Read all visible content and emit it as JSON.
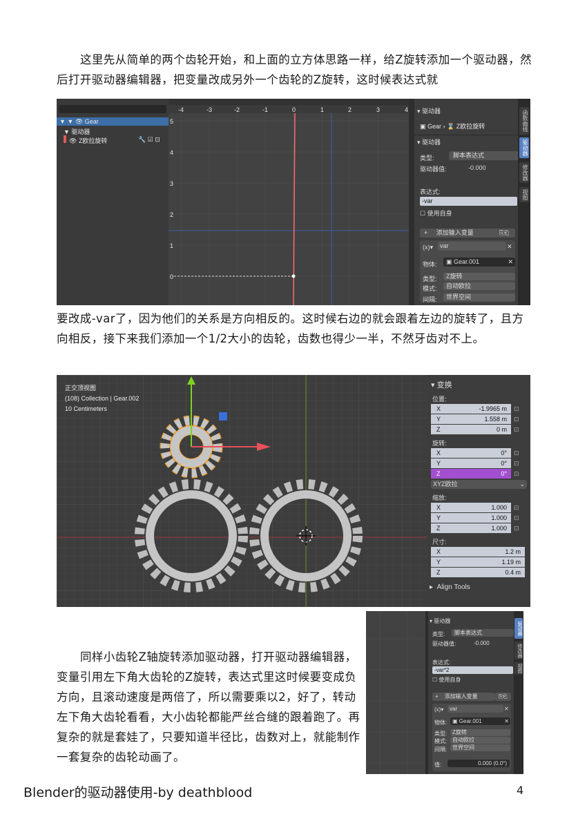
{
  "para1": "这里先从简单的两个齿轮开始，和上面的立方体思路一样，给Z旋转添加一个驱动器，然后打开驱动器编辑器，把变量改成另外一个齿轮的Z旋转，这时候表达式就",
  "para2": "要改成-var了，因为他们的关系是方向相反的。这时候右边的就会跟着左边的旋转了，且方向相反，接下来我们添加一个1/2大小的齿轮，齿数也得少一半，不然牙齿对不上。",
  "para3": "同样小齿轮Z轴旋转添加驱动器，打开驱动器编辑器，变量引用左下角大齿轮的Z旋转，表达式里这时候要变成负方向，且滚动速度是两倍了，所以需要乘以2，好了，转动左下角大齿轮看看，大小齿轮都能严丝合缝的跟着跑了。再复杂的就是套娃了，只要知道半径比，齿数对上，就能制作一套复杂的齿轮动画了。",
  "footer": {
    "title": "Blender的驱动器使用-by deathblood",
    "page": "4"
  },
  "ss1": {
    "outliner": {
      "gear": "Gear",
      "drivers": "驱动器",
      "zrot": "Z欧拉旋转"
    },
    "xticks": [
      "-4",
      "-3",
      "-2",
      "-1",
      "0",
      "1",
      "2",
      "3",
      "4"
    ],
    "yticks": [
      "5",
      "4",
      "3",
      "2",
      "1",
      "0"
    ],
    "panel": {
      "header": "驱动器",
      "obj": "Gear",
      "prop": "Z欧拉旋转",
      "driver_header": "驱动器",
      "type_label": "类型:",
      "type_value": "脚本表达式",
      "value_label": "驱动器值:",
      "value": "-0.000",
      "expr_label": "表达式:",
      "expr": "-var",
      "use_self": "使用自身",
      "add_var": "添加输入变量",
      "var_name": "var",
      "obj_label": "物体:",
      "obj_value": "Gear.001",
      "ttype_label": "类型:",
      "ttype": "Z旋转",
      "mode_label": "模式:",
      "mode": "自动欧拉",
      "space_label": "间隔:",
      "space": "世界空间"
    },
    "tabs": [
      "函数曲线",
      "驱动器",
      "修改器",
      "视图"
    ]
  },
  "ss2": {
    "overlay": [
      "正交顶视图",
      "(108) Collection | Gear.002",
      "10 Centimeters"
    ],
    "panel": {
      "header": "变换",
      "location": "位置:",
      "loc": [
        "-1.9965 m",
        "1.558 m",
        "0 m"
      ],
      "rotation": "旋转:",
      "rot": [
        "0°",
        "0°",
        "0°"
      ],
      "mode": "XYZ欧拉",
      "scale": "缩放:",
      "scl": [
        "1.000",
        "1.000",
        "1.000"
      ],
      "dims": "尺寸:",
      "dim": [
        "1.2 m",
        "1.19 m",
        "0.4 m"
      ],
      "align": "Align Tools",
      "axes": [
        "X",
        "Y",
        "Z"
      ]
    }
  },
  "ss3": {
    "header": "驱动器",
    "type_label": "类型:",
    "type_value": "脚本表达式",
    "value_label": "驱动器值:",
    "value": "-0.000",
    "expr_label": "表达式:",
    "expr": "-var*2",
    "use_self": "使用自身",
    "add_var": "添加输入变量",
    "var_name": "var",
    "obj_label": "物体:",
    "obj_value": "Gear.001",
    "ttype_label": "类型:",
    "ttype": "Z旋转",
    "mode_label": "模式:",
    "mode": "自动欧拉",
    "space_label": "间隔:",
    "space": "世界空间",
    "v_label": "值:",
    "v": "0.000 (0.0°)",
    "tabs": [
      "驱动器",
      "修改器",
      "视图"
    ]
  }
}
